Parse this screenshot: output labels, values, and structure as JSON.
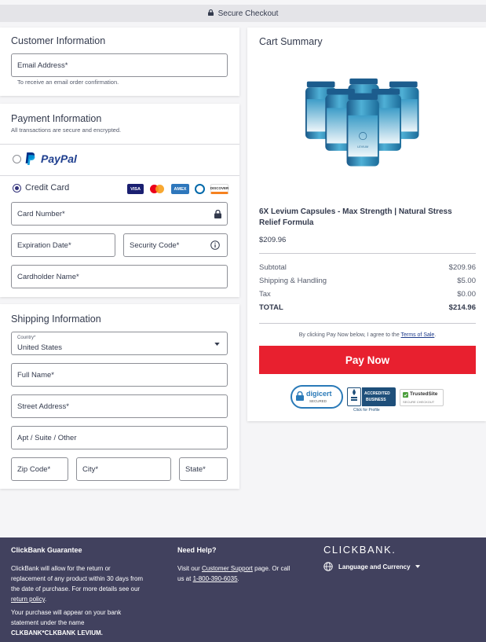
{
  "topbar": {
    "label": "Secure Checkout"
  },
  "customer": {
    "title": "Customer Information",
    "email_label": "Email Address*",
    "email_note": "To receive an email order confirmation."
  },
  "payment": {
    "title": "Payment Information",
    "subtitle": "All transactions are secure and encrypted.",
    "paypal_label": "PayPal",
    "credit_label": "Credit Card",
    "card_brands": [
      "VISA",
      "Mastercard",
      "AMEX",
      "Diners",
      "DISCOVER"
    ],
    "card_number_label": "Card Number*",
    "expiration_label": "Expiration Date*",
    "security_label": "Security Code*",
    "cardholder_label": "Cardholder Name*"
  },
  "shipping": {
    "title": "Shipping Information",
    "country_label": "Country*",
    "country_value": "United States",
    "full_name_label": "Full Name*",
    "street_label": "Street Address*",
    "apt_label": "Apt / Suite / Other",
    "zip_label": "Zip Code*",
    "city_label": "City*",
    "state_label": "State*"
  },
  "cart": {
    "title": "Cart Summary",
    "product_name_line1": "6X Levium Capsules - Max Strength | Natural Stress",
    "product_name_line2": "Relief Formula",
    "product_brand_label": "LEVIUM",
    "price": "$209.96",
    "subtotal_label": "Subtotal",
    "subtotal_value": "$209.96",
    "shipping_label": "Shipping & Handling",
    "shipping_value": "$5.00",
    "tax_label": "Tax",
    "tax_value": "$0.00",
    "total_label": "TOTAL",
    "total_value": "$214.96",
    "terms_prefix": "By clicking Pay Now below, I agree to the ",
    "terms_link": "Terms of Sale",
    "terms_suffix": ".",
    "pay_button": "Pay Now",
    "badges": {
      "digicert": "digicert",
      "digicert_sub": "SECURED",
      "bbb_line1": "ACCREDITED",
      "bbb_line2": "BUSINESS",
      "bbb_click": "Click for Profile",
      "trusted": "TrustedSite",
      "trusted_sub": "SECURE CHECKOUT"
    }
  },
  "footer": {
    "guarantee_title": "ClickBank Guarantee",
    "guarantee_line1": "ClickBank will allow for the return or",
    "guarantee_line2": "replacement of any product within 30 days from",
    "guarantee_line3": "the date of purchase. For more details see our",
    "guarantee_link": "return policy",
    "guarantee_dot": ".",
    "statement_line1": "Your purchase will appear on your bank",
    "statement_line2": "statement under the name",
    "statement_line3": "CLKBANK*CLKBANK LEVIUM.",
    "help_title": "Need Help?",
    "help_prefix": "Visit our ",
    "help_link": "Customer Support",
    "help_mid": " page. Or call",
    "help_us_at": "us at ",
    "help_phone": "1-800-390-6035",
    "help_end": ".",
    "brand": "CLICKBANK.",
    "language_label": "Language and Currency"
  },
  "colors": {
    "pay_button": "#e8202f",
    "footer_bg": "#41415e",
    "paypal_dark": "#003087",
    "paypal_light": "#009cde",
    "radio_selected": "#32327a"
  }
}
